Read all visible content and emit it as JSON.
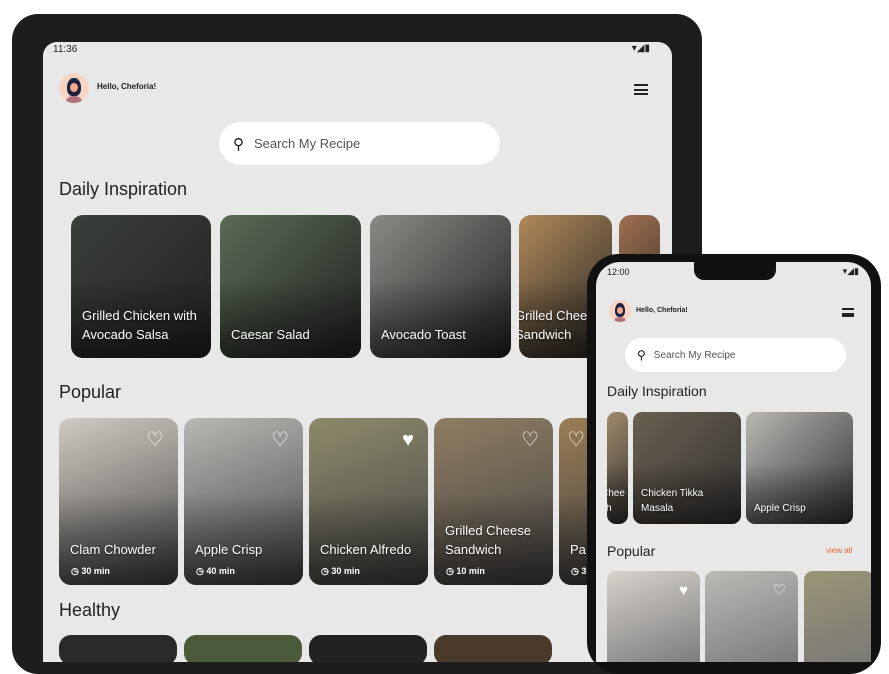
{
  "tablet": {
    "status": {
      "time": "11:36"
    },
    "greeting": "Hello, Cheforia!",
    "search_placeholder": "Search My Recipe",
    "daily_title": "Daily Inspiration",
    "daily": [
      {
        "title": "Grilled Chicken with Avocado Salsa",
        "color": "#3a3f3a"
      },
      {
        "title": "Caesar Salad",
        "color": "#5a6a55"
      },
      {
        "title": "Avocado Toast",
        "color": "#8a8a85"
      },
      {
        "title": "Grilled Cheese Sandwich",
        "color": "#b08a5a"
      },
      {
        "title": "",
        "color": "#a07050"
      }
    ],
    "popular_title": "Popular",
    "popular": [
      {
        "title": "Clam Chowder",
        "time": "30 min",
        "favorite": false,
        "color": "#cfcac2"
      },
      {
        "title": "Apple Crisp",
        "time": "40 min",
        "favorite": false,
        "color": "#b9b7b3"
      },
      {
        "title": "Chicken Alfredo",
        "time": "30 min",
        "favorite": true,
        "color": "#8d8a6a"
      },
      {
        "title": "Grilled Cheese Sandwich",
        "time": "10 min",
        "favorite": false,
        "color": "#8f7d62"
      },
      {
        "title": "Pa",
        "time": "3",
        "favorite": false,
        "color": "#9a7d55"
      }
    ],
    "healthy_title": "Healthy"
  },
  "phone": {
    "status": {
      "time": "12:00"
    },
    "greeting": "Hello, Cheforia!",
    "search_placeholder": "Search My Recipe",
    "daily_title": "Daily Inspiration",
    "daily": [
      {
        "title": "Chee ch",
        "color": "#a08a6a"
      },
      {
        "title": "Chicken Tikka Masala",
        "color": "#6a6050"
      },
      {
        "title": "Apple Crisp",
        "color": "#b9b7b3"
      }
    ],
    "popular_title": "Popular",
    "view_all": "view all",
    "accent": "#f0643c",
    "popular": [
      {
        "favorite": true,
        "color": "#d6d2cc"
      },
      {
        "favorite": false,
        "color": "#bcbab6"
      },
      {
        "favorite": false,
        "color": "#9b9575"
      }
    ]
  }
}
